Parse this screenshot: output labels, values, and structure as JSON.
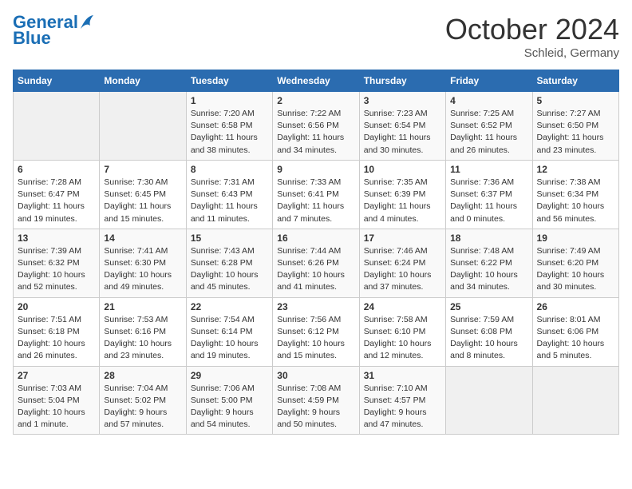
{
  "header": {
    "logo_line1": "General",
    "logo_line2": "Blue",
    "month_year": "October 2024",
    "location": "Schleid, Germany"
  },
  "weekdays": [
    "Sunday",
    "Monday",
    "Tuesday",
    "Wednesday",
    "Thursday",
    "Friday",
    "Saturday"
  ],
  "weeks": [
    [
      {
        "day": "",
        "empty": true
      },
      {
        "day": "",
        "empty": true
      },
      {
        "day": "1",
        "sunrise": "7:20 AM",
        "sunset": "6:58 PM",
        "daylight": "11 hours and 38 minutes."
      },
      {
        "day": "2",
        "sunrise": "7:22 AM",
        "sunset": "6:56 PM",
        "daylight": "11 hours and 34 minutes."
      },
      {
        "day": "3",
        "sunrise": "7:23 AM",
        "sunset": "6:54 PM",
        "daylight": "11 hours and 30 minutes."
      },
      {
        "day": "4",
        "sunrise": "7:25 AM",
        "sunset": "6:52 PM",
        "daylight": "11 hours and 26 minutes."
      },
      {
        "day": "5",
        "sunrise": "7:27 AM",
        "sunset": "6:50 PM",
        "daylight": "11 hours and 23 minutes."
      }
    ],
    [
      {
        "day": "6",
        "sunrise": "7:28 AM",
        "sunset": "6:47 PM",
        "daylight": "11 hours and 19 minutes."
      },
      {
        "day": "7",
        "sunrise": "7:30 AM",
        "sunset": "6:45 PM",
        "daylight": "11 hours and 15 minutes."
      },
      {
        "day": "8",
        "sunrise": "7:31 AM",
        "sunset": "6:43 PM",
        "daylight": "11 hours and 11 minutes."
      },
      {
        "day": "9",
        "sunrise": "7:33 AM",
        "sunset": "6:41 PM",
        "daylight": "11 hours and 7 minutes."
      },
      {
        "day": "10",
        "sunrise": "7:35 AM",
        "sunset": "6:39 PM",
        "daylight": "11 hours and 4 minutes."
      },
      {
        "day": "11",
        "sunrise": "7:36 AM",
        "sunset": "6:37 PM",
        "daylight": "11 hours and 0 minutes."
      },
      {
        "day": "12",
        "sunrise": "7:38 AM",
        "sunset": "6:34 PM",
        "daylight": "10 hours and 56 minutes."
      }
    ],
    [
      {
        "day": "13",
        "sunrise": "7:39 AM",
        "sunset": "6:32 PM",
        "daylight": "10 hours and 52 minutes."
      },
      {
        "day": "14",
        "sunrise": "7:41 AM",
        "sunset": "6:30 PM",
        "daylight": "10 hours and 49 minutes."
      },
      {
        "day": "15",
        "sunrise": "7:43 AM",
        "sunset": "6:28 PM",
        "daylight": "10 hours and 45 minutes."
      },
      {
        "day": "16",
        "sunrise": "7:44 AM",
        "sunset": "6:26 PM",
        "daylight": "10 hours and 41 minutes."
      },
      {
        "day": "17",
        "sunrise": "7:46 AM",
        "sunset": "6:24 PM",
        "daylight": "10 hours and 37 minutes."
      },
      {
        "day": "18",
        "sunrise": "7:48 AM",
        "sunset": "6:22 PM",
        "daylight": "10 hours and 34 minutes."
      },
      {
        "day": "19",
        "sunrise": "7:49 AM",
        "sunset": "6:20 PM",
        "daylight": "10 hours and 30 minutes."
      }
    ],
    [
      {
        "day": "20",
        "sunrise": "7:51 AM",
        "sunset": "6:18 PM",
        "daylight": "10 hours and 26 minutes."
      },
      {
        "day": "21",
        "sunrise": "7:53 AM",
        "sunset": "6:16 PM",
        "daylight": "10 hours and 23 minutes."
      },
      {
        "day": "22",
        "sunrise": "7:54 AM",
        "sunset": "6:14 PM",
        "daylight": "10 hours and 19 minutes."
      },
      {
        "day": "23",
        "sunrise": "7:56 AM",
        "sunset": "6:12 PM",
        "daylight": "10 hours and 15 minutes."
      },
      {
        "day": "24",
        "sunrise": "7:58 AM",
        "sunset": "6:10 PM",
        "daylight": "10 hours and 12 minutes."
      },
      {
        "day": "25",
        "sunrise": "7:59 AM",
        "sunset": "6:08 PM",
        "daylight": "10 hours and 8 minutes."
      },
      {
        "day": "26",
        "sunrise": "8:01 AM",
        "sunset": "6:06 PM",
        "daylight": "10 hours and 5 minutes."
      }
    ],
    [
      {
        "day": "27",
        "sunrise": "7:03 AM",
        "sunset": "5:04 PM",
        "daylight": "10 hours and 1 minute."
      },
      {
        "day": "28",
        "sunrise": "7:04 AM",
        "sunset": "5:02 PM",
        "daylight": "9 hours and 57 minutes."
      },
      {
        "day": "29",
        "sunrise": "7:06 AM",
        "sunset": "5:00 PM",
        "daylight": "9 hours and 54 minutes."
      },
      {
        "day": "30",
        "sunrise": "7:08 AM",
        "sunset": "4:59 PM",
        "daylight": "9 hours and 50 minutes."
      },
      {
        "day": "31",
        "sunrise": "7:10 AM",
        "sunset": "4:57 PM",
        "daylight": "9 hours and 47 minutes."
      },
      {
        "day": "",
        "empty": true
      },
      {
        "day": "",
        "empty": true
      }
    ]
  ]
}
